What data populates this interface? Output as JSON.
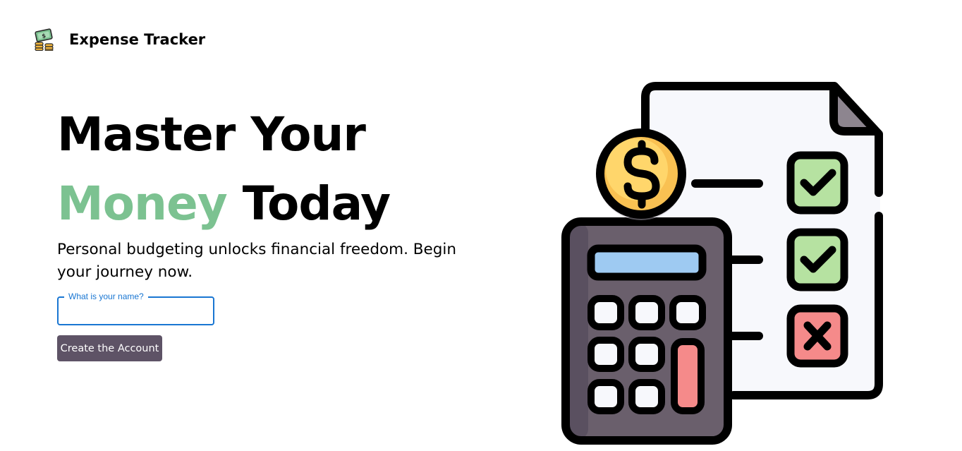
{
  "app": {
    "brand": "Expense Tracker",
    "logo_icon": "money-stack-icon"
  },
  "hero": {
    "headline_line1": "Master Your",
    "headline_accent": "Money",
    "headline_line2_rest": " Today",
    "subtitle": "Personal budgeting unlocks financial freedom. Begin your journey now."
  },
  "form": {
    "name_label": "What is your name?",
    "name_value": "",
    "submit_label": "Create the Account"
  },
  "colors": {
    "accent": "#7cc291",
    "button": "#5e5366",
    "focus": "#1976d2"
  },
  "illustration": {
    "icon": "calculator-checklist-icon"
  }
}
